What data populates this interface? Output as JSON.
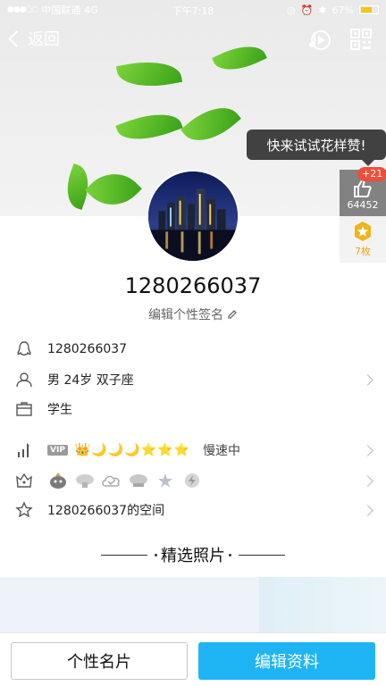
{
  "status_bar": {
    "carrier": "中国联通",
    "network": "4G",
    "time": "下午7:18",
    "battery": "67%",
    "battery_level": 0.67
  },
  "nav": {
    "back_label": "返回",
    "music_icon": "music-disc-icon",
    "qr_icon": "qr-code-icon"
  },
  "cover": {
    "tooltip": "快来试试花样赞!"
  },
  "likes": {
    "plus": "+21",
    "count": "64452"
  },
  "medals": {
    "count": "7枚"
  },
  "profile": {
    "nickname": "1280266037",
    "signature": "编辑个性签名"
  },
  "info_rows": {
    "qq_number": "1280266037",
    "personal": "男 24岁 双子座",
    "occupation": "学生",
    "level_tag": "VIP",
    "level_icons": [
      "👑",
      "🌙",
      "🌙",
      "🌙",
      "⭐",
      "⭐",
      "⭐"
    ],
    "level_speed": "慢速中",
    "qzone": "1280266037的空间"
  },
  "section": {
    "title": "精选照片"
  },
  "bottom": {
    "card_button": "个性名片",
    "edit_button": "编辑资料"
  },
  "colors": {
    "accent": "#1fb5f4",
    "leaf_green": "#4caf1d",
    "like_red": "#f04d3b",
    "medal_gold": "#e7a713"
  }
}
